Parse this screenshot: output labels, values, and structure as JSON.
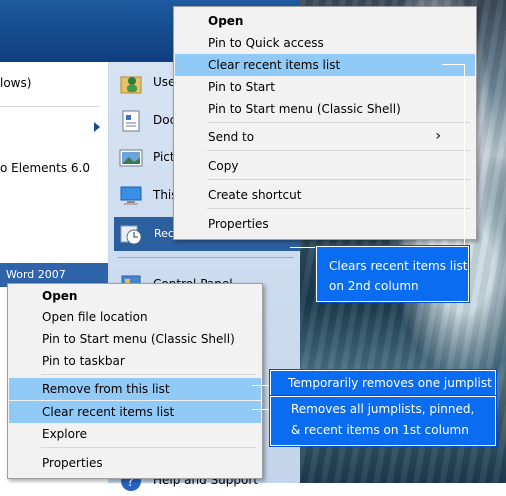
{
  "left_column": {
    "item_suffix_1": "lows)",
    "item_suffix_2": "o Elements 6.0",
    "item_suffix_3": "Word 2007"
  },
  "right_column": {
    "items": [
      {
        "label": "Use",
        "icon": "user-folder-icon"
      },
      {
        "label": "Doc",
        "icon": "documents-icon"
      },
      {
        "label": "Pict",
        "icon": "pictures-icon"
      },
      {
        "label": "This",
        "icon": "computer-icon"
      },
      {
        "label": "Recent Items",
        "icon": "recent-items-icon"
      },
      {
        "label": "Control Panel",
        "icon": "control-panel-icon"
      },
      {
        "label": "Help and Support",
        "icon": "help-icon"
      }
    ]
  },
  "top_menu": {
    "items": [
      {
        "label": "Open",
        "bold": true
      },
      {
        "label": "Pin to Quick access"
      },
      {
        "label": "Clear recent items list",
        "highlighted": true
      },
      {
        "label": "Pin to Start"
      },
      {
        "label": "Pin to Start menu (Classic Shell)"
      },
      {
        "label": "Send to",
        "submenu": true
      },
      {
        "label": "Copy"
      },
      {
        "label": "Create shortcut"
      },
      {
        "label": "Properties"
      }
    ],
    "submenu_glyph": "›"
  },
  "bottom_menu": {
    "items": [
      {
        "label": "Open",
        "bold": true
      },
      {
        "label": "Open file location"
      },
      {
        "label": "Pin to Start menu (Classic Shell)"
      },
      {
        "label": "Pin to taskbar"
      },
      {
        "label": "Remove from this list",
        "highlighted": true
      },
      {
        "label": "Clear recent items list",
        "highlighted": true
      },
      {
        "label": "Explore"
      },
      {
        "label": "Properties"
      }
    ]
  },
  "callouts": {
    "top": {
      "line1": "Clears recent items list",
      "line2": "on 2nd column"
    },
    "remove": {
      "line1": "Temporarily removes one jumplist"
    },
    "clear": {
      "line1": "Removes all jumplists, pinned,",
      "line2": "& recent items on 1st column"
    }
  },
  "colors": {
    "callout": "#0a6cf0",
    "menu_highlight": "#91c9f7",
    "start_menu_blue": "#1d5aa0"
  }
}
